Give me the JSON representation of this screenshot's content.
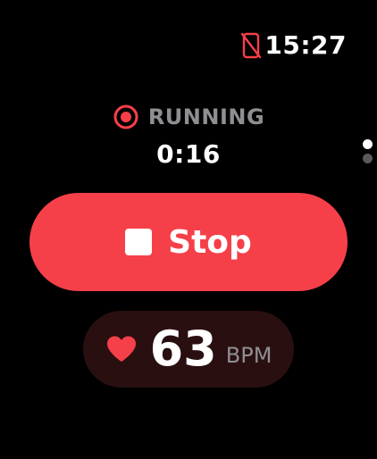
{
  "status_bar": {
    "icon": "phone-disconnected-icon",
    "time": "15:27"
  },
  "session": {
    "icon": "record-icon",
    "status": "RUNNING",
    "elapsed": "0:16"
  },
  "pager": {
    "pages": 2,
    "active_index": 0
  },
  "stop_button": {
    "icon": "stop-icon",
    "label": "Stop"
  },
  "heart_rate": {
    "icon": "heart-icon",
    "value": "63",
    "unit": "BPM"
  },
  "colors": {
    "background": "#000000",
    "accent_red": "#f5404a",
    "heart_rate_pill": "#2a0f10",
    "secondary_text": "#8e8e93"
  }
}
